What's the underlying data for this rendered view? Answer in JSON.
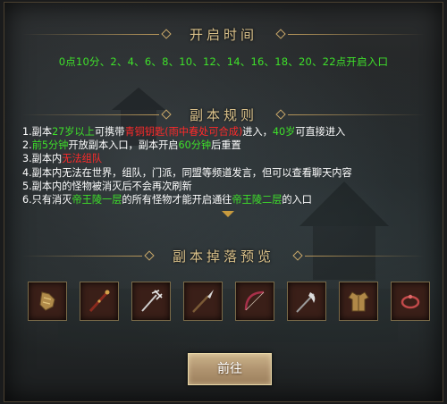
{
  "open_time": {
    "title": "开启时间",
    "times": "0点10分、2、4、6、8、10、12、14、16、18、20、22点开启入口"
  },
  "rules": {
    "title": "副本规则",
    "lines": [
      [
        {
          "text": "1.副本",
          "color": "white"
        },
        {
          "text": "27岁以上",
          "color": "green"
        },
        {
          "text": "可携带",
          "color": "white"
        },
        {
          "text": "青铜钥匙(雨中春处可合成)",
          "color": "red"
        },
        {
          "text": "进入，",
          "color": "white"
        },
        {
          "text": "40岁",
          "color": "green"
        },
        {
          "text": "可直接进入",
          "color": "white"
        }
      ],
      [
        {
          "text": "2.",
          "color": "white"
        },
        {
          "text": "前5分钟",
          "color": "green"
        },
        {
          "text": "开放副本入口，副本开启",
          "color": "white"
        },
        {
          "text": "60分钟",
          "color": "green"
        },
        {
          "text": "后重置",
          "color": "white"
        }
      ],
      [
        {
          "text": "3.副本内",
          "color": "white"
        },
        {
          "text": "无法组队",
          "color": "red"
        }
      ],
      [
        {
          "text": "4.副本内无法在世界，组队，门派，同盟等频道发言，但可以查看聊天内容",
          "color": "white"
        }
      ],
      [
        {
          "text": "5.副本内的怪物被消灭后不会再次刷新",
          "color": "white"
        }
      ],
      [
        {
          "text": "6.只有消灭",
          "color": "white"
        },
        {
          "text": "帝王陵一层",
          "color": "green"
        },
        {
          "text": "的所有怪物才能开启通往",
          "color": "white"
        },
        {
          "text": "帝王陵二层",
          "color": "green"
        },
        {
          "text": "的入口",
          "color": "white"
        }
      ]
    ]
  },
  "drops": {
    "title": "副本掉落预览",
    "items": [
      {
        "icon": "gauntlet-icon"
      },
      {
        "icon": "staff-icon"
      },
      {
        "icon": "trident-icon"
      },
      {
        "icon": "spear-icon"
      },
      {
        "icon": "bow-icon"
      },
      {
        "icon": "halberd-icon"
      },
      {
        "icon": "armor-icon"
      },
      {
        "icon": "ring-icon"
      }
    ]
  },
  "go_button": {
    "label": "前往"
  },
  "colors": {
    "green": "#3ee02a",
    "red": "#ff2a2a",
    "gold": "#d9c089"
  }
}
